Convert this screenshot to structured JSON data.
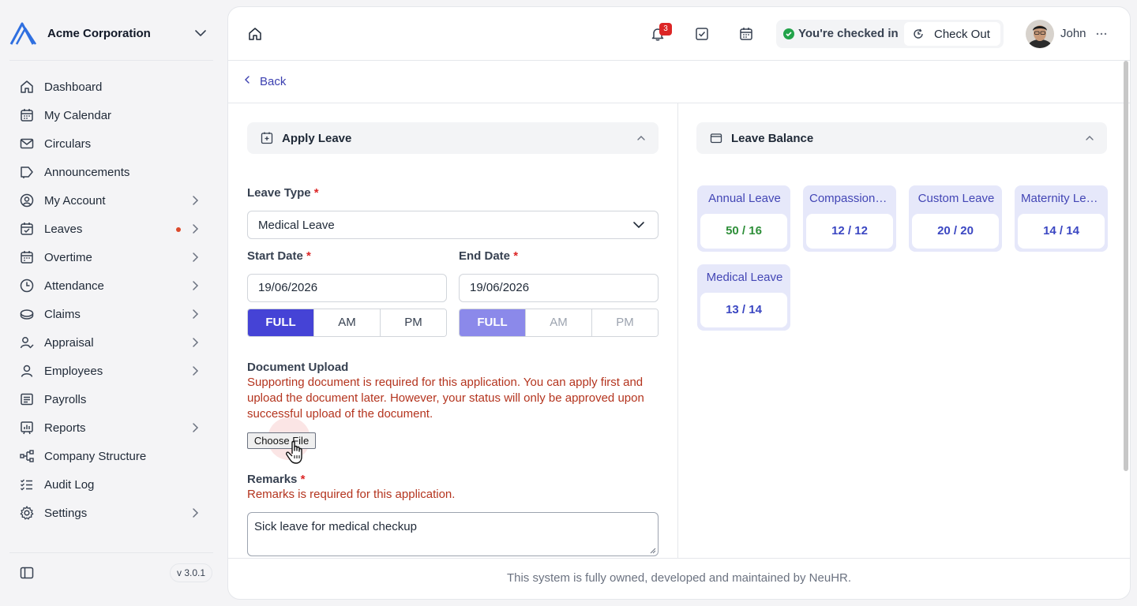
{
  "sidebar": {
    "org_name": "Acme Corporation",
    "items": [
      {
        "label": "Dashboard",
        "icon": "home-icon"
      },
      {
        "label": "My Calendar",
        "icon": "calendar-icon"
      },
      {
        "label": "Circulars",
        "icon": "mail-icon"
      },
      {
        "label": "Announcements",
        "icon": "megaphone-icon"
      },
      {
        "label": "My Account",
        "icon": "user-circle-icon"
      },
      {
        "label": "Leaves",
        "icon": "calendar-check-icon"
      },
      {
        "label": "Overtime",
        "icon": "calendar-plus-icon"
      },
      {
        "label": "Attendance",
        "icon": "clock-icon"
      },
      {
        "label": "Claims",
        "icon": "coin-icon"
      },
      {
        "label": "Appraisal",
        "icon": "user-check-icon"
      },
      {
        "label": "Employees",
        "icon": "user-icon"
      },
      {
        "label": "Payrolls",
        "icon": "receipt-icon"
      },
      {
        "label": "Reports",
        "icon": "report-icon"
      },
      {
        "label": "Company Structure",
        "icon": "hierarchy-icon"
      },
      {
        "label": "Audit Log",
        "icon": "checklist-icon"
      },
      {
        "label": "Settings",
        "icon": "gear-icon"
      }
    ],
    "version": "v 3.0.1"
  },
  "topbar": {
    "notification_count": "3",
    "checkin_status": "You're checked in",
    "checkout_label": "Check Out",
    "user_name": "John"
  },
  "back_label": "Back",
  "apply_leave": {
    "title": "Apply Leave",
    "leave_type_label": "Leave Type",
    "leave_type_value": "Medical Leave",
    "start_date_label": "Start Date",
    "start_date_value": "19/06/2026",
    "end_date_label": "End Date",
    "end_date_value": "19/06/2026",
    "day_options": [
      "FULL",
      "AM",
      "PM"
    ],
    "start_selected": "FULL",
    "end_selected": "FULL",
    "document_label": "Document Upload",
    "document_error": "Supporting document is required for this application. You can apply first and upload the document later. However, your status will only be approved upon successful upload of the document.",
    "choose_file_label": "Choose File",
    "remarks_label": "Remarks",
    "remarks_error": "Remarks is required for this application.",
    "remarks_value": "Sick leave for medical checkup",
    "required_mark": "*"
  },
  "leave_balance": {
    "title": "Leave Balance",
    "cards": [
      {
        "name": "Annual Leave",
        "value": "50 / 16",
        "color": "#2f8f3a"
      },
      {
        "name": "Compassionate Leave",
        "value": "12 / 12",
        "color": "#3b47c2"
      },
      {
        "name": "Custom Leave",
        "value": "20 / 20",
        "color": "#3b47c2"
      },
      {
        "name": "Maternity Leave",
        "value": "14 / 14",
        "color": "#3b47c2"
      },
      {
        "name": "Medical Leave",
        "value": "13 / 14",
        "color": "#3b47c2"
      }
    ]
  },
  "footer_text": "This system is fully owned, developed and maintained by NeuHR.",
  "colors": {
    "primary": "#4543d6",
    "primary_disabled": "#8b89ea",
    "error": "#b4341e",
    "required": "#dc2626",
    "link": "#3b3fb0"
  }
}
